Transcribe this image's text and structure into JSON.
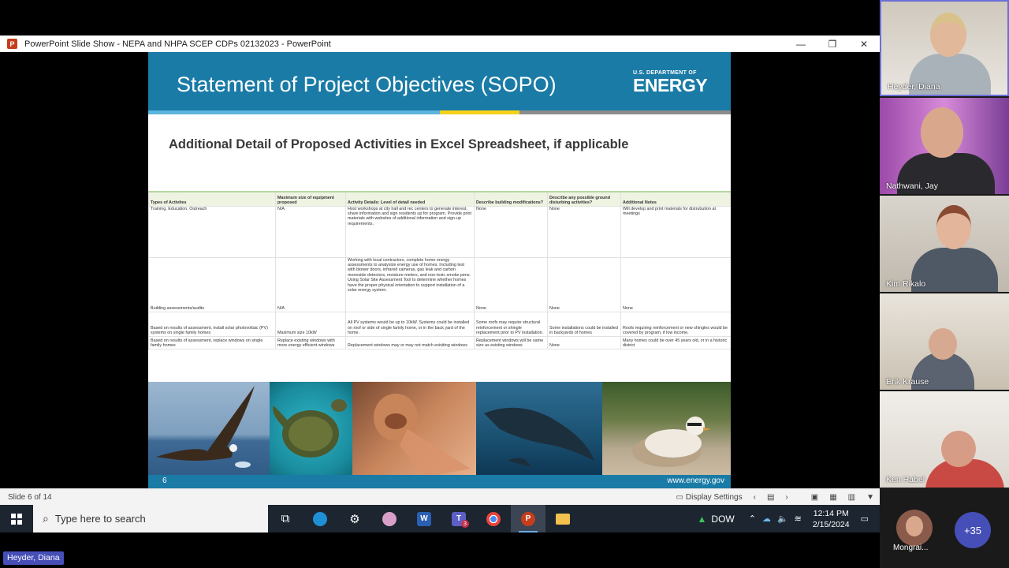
{
  "window": {
    "title": "PowerPoint Slide Show  -  NEPA and NHPA SCEP CDPs 02132023 - PowerPoint",
    "min_glyph": "—",
    "restore_glyph": "❐",
    "close_glyph": "✕"
  },
  "slide": {
    "title": "Statement of Project Objectives (SOPO)",
    "logo_small": "U.S. DEPARTMENT OF",
    "logo_big": "ENERGY",
    "subtitle": "Additional Detail of Proposed Activities in Excel Spreadsheet, if applicable",
    "page_number": "6",
    "website": "www.energy.gov",
    "colors": {
      "header": "#1a7ba6",
      "stripe_light": "#5ab4dc",
      "stripe_yellow": "#f4d11a",
      "stripe_gray": "#8c8c8c"
    }
  },
  "sheet": {
    "headers": [
      "Types of Activites",
      "Maximum size of equipment proposed",
      "Activity Details: Level of detail needed",
      "Describe building modifications?",
      "Describe any possible ground disturbing activities?",
      "Additional Notes"
    ],
    "rows": [
      [
        "Training, Education, Outreach",
        "N/A",
        "Host workshops at city hall and rec centers to generate interest, share information and sign residents up for program.  Provide print materials with websites of additional information and sign-up requirements.",
        "None",
        "None",
        "Will develop and print materials for distrubution at meetings"
      ],
      [
        "Building assessments/audits",
        "N/A",
        "Working with local contractors, complete home energy assessments to analysize energy use of homes. Including test with blower doors, infrared cameras, gas leak and carbon monoxide detectors, moisture meters, and non-toxic smoke pens.\nUsing Solar Site Assessment Tool to determine whether homes have the proper physical orientation to support installation of a solar energy system.",
        "None",
        "None",
        "None"
      ],
      [
        "Based on results of assessment, install solar photovoltaic (PV) systems on single family homes",
        "Maximum size 10kW",
        "All PV systems would be up to 10kW. Systems could be installed on roof or side of single family home, or in the back yard of the home.",
        "Some roofs may require structural reinforcement  or shingle replacement prior to PV installation.",
        "Some installations could be installed in backyards of homes",
        "Roofs requiring reinforcement or new shingles would be covered by program, if low income."
      ],
      [
        "Based on results of assessment, replace windows on single family homes",
        "Replace existing windows with more energy efficient windows",
        "Replacement windows may or may not match exisiting windows",
        "Replacement windows will be same size as existing windows",
        "None",
        "Many homes could be over 45 years old, or in a historic district"
      ]
    ]
  },
  "statusbar": {
    "slide_info": "Slide 6 of 14",
    "display_settings": "Display Settings"
  },
  "taskbar": {
    "search_placeholder": "Type here to search",
    "stock": "DOW",
    "time": "12:14 PM",
    "date": "2/15/2024",
    "teams_badge": "3"
  },
  "participants": [
    {
      "name": "Heyder, Diana"
    },
    {
      "name": "Nathwani, Jay"
    },
    {
      "name": "Kim Rikalo"
    },
    {
      "name": "Erik Krause"
    },
    {
      "name": "Ken Habel"
    }
  ],
  "self": {
    "name": "Mongrai..."
  },
  "more_count": "+35",
  "active_speaker": "Heyder, Diana"
}
